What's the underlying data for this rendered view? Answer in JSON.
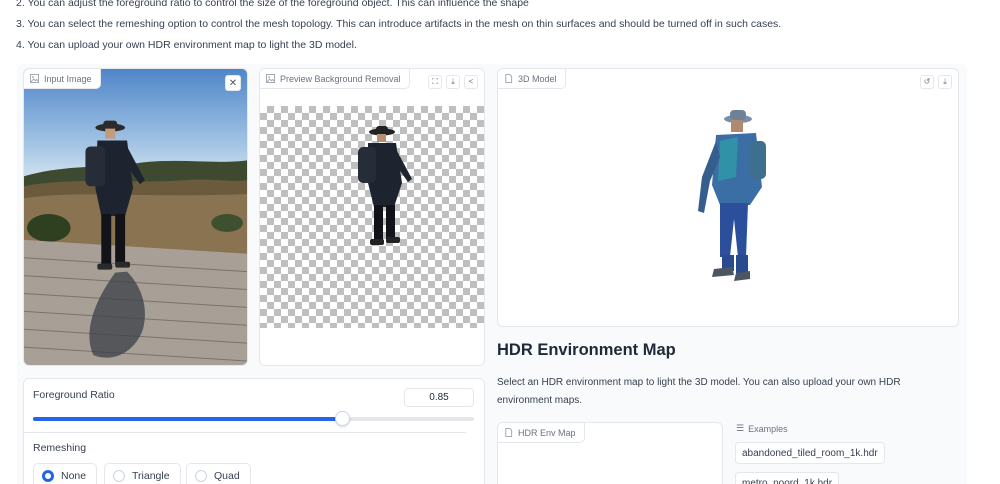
{
  "instructions": [
    "2. You can adjust the foreground ratio to control the size of the foreground object. This can influence the shape",
    "3. You can select the remeshing option to control the mesh topology. This can introduce artifacts in the mesh on thin surfaces and should be turned off in such cases.",
    "4. You can upload your own HDR environment map to light the 3D model."
  ],
  "input_image": {
    "label": "Input Image",
    "clear_icon": "close-icon"
  },
  "preview": {
    "label": "Preview Background Removal",
    "tool_icons": [
      "fullscreen-icon",
      "download-icon",
      "share-icon"
    ]
  },
  "model3d": {
    "label": "3D Model",
    "tool_icons": [
      "undo-icon",
      "download-icon"
    ]
  },
  "hdr": {
    "title": "HDR Environment Map",
    "description": "Select an HDR environment map to light the 3D model. You can also upload your own HDR environment maps.",
    "upload_label": "HDR Env Map",
    "examples_label": "Examples",
    "examples": [
      "abandoned_tiled_room_1k.hdr",
      "metro_noord_1k.hdr"
    ]
  },
  "foreground_ratio": {
    "label": "Foreground Ratio",
    "value": "0.85",
    "min": 0.5,
    "max": 1.0
  },
  "remeshing": {
    "label": "Remeshing",
    "options": [
      "None",
      "Triangle",
      "Quad"
    ],
    "selected": "None"
  },
  "colors": {
    "accent": "#2563eb",
    "border": "#e5e7eb",
    "panel_bg": "#f9fafb"
  }
}
